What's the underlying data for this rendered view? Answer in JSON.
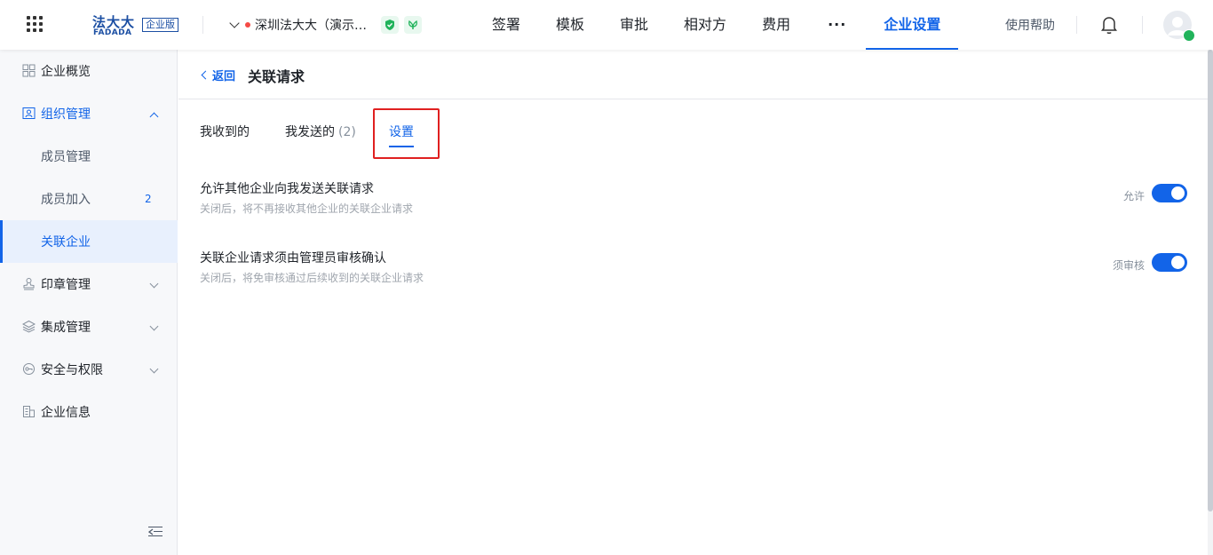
{
  "topbar": {
    "logo_cn": "法大大",
    "logo_en": "FADADA",
    "logo_badge": "企业版",
    "org_name": "深圳法大大（演示…",
    "nav": [
      "签署",
      "模板",
      "审批",
      "相对方",
      "费用",
      "···",
      "企业设置"
    ],
    "active_nav": "企业设置",
    "help": "使用帮助"
  },
  "sidebar": {
    "items": [
      {
        "label": "企业概览",
        "icon": "overview-icon"
      },
      {
        "label": "组织管理",
        "icon": "org-icon",
        "expanded": true
      },
      {
        "label": "成员管理"
      },
      {
        "label": "成员加入",
        "count": "2"
      },
      {
        "label": "关联企业",
        "selected": true
      },
      {
        "label": "印章管理",
        "icon": "seal-icon"
      },
      {
        "label": "集成管理",
        "icon": "layers-icon"
      },
      {
        "label": "安全与权限",
        "icon": "key-icon"
      },
      {
        "label": "企业信息",
        "icon": "building-icon"
      }
    ]
  },
  "page": {
    "back_label": "返回",
    "title": "关联请求",
    "tabs": [
      {
        "label": "我收到的"
      },
      {
        "label": "我发送的",
        "count": "(2)"
      },
      {
        "label": "设置",
        "active": true
      }
    ],
    "settings": [
      {
        "title": "允许其他企业向我发送关联请求",
        "desc": "关闭后，将不再接收其他企业的关联企业请求",
        "state_label": "允许",
        "on": true
      },
      {
        "title": "关联企业请求须由管理员审核确认",
        "desc": "关闭后，将免审核通过后续收到的关联企业请求",
        "state_label": "须审核",
        "on": true
      }
    ]
  },
  "colors": {
    "accent": "#1264e8",
    "highlight": "#e02020",
    "badge_green": "#21b35b"
  }
}
